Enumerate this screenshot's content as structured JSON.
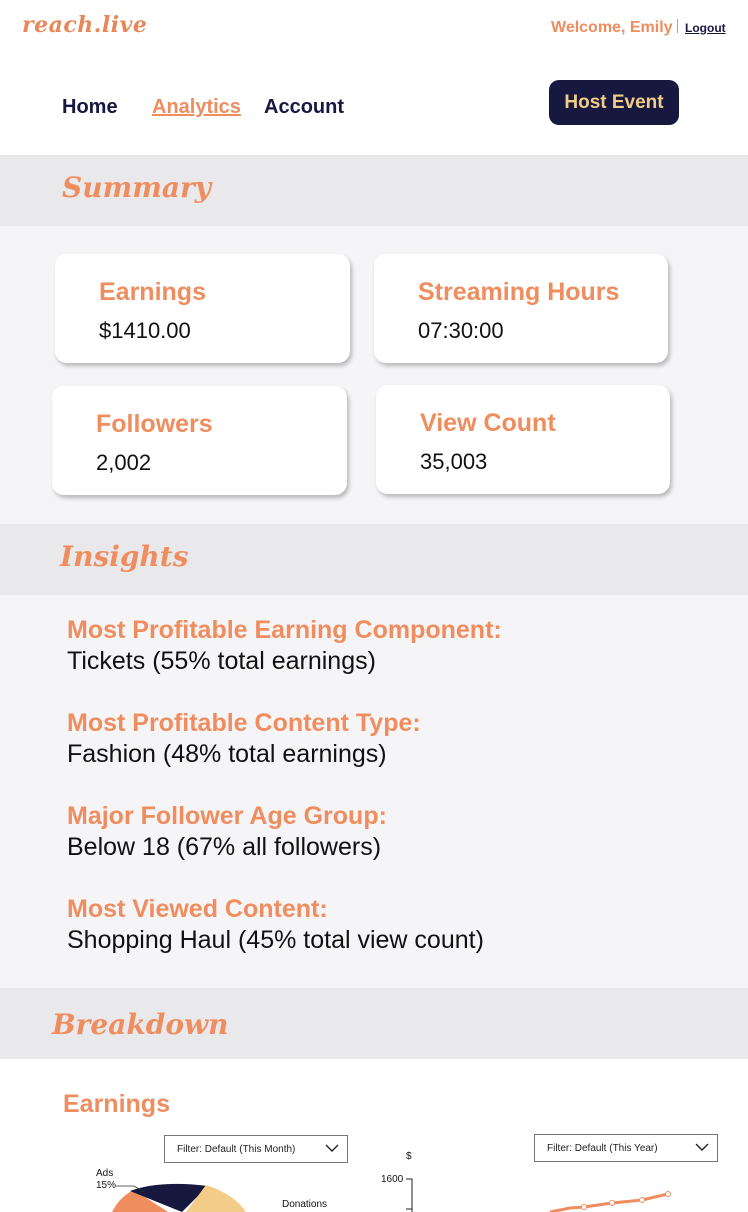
{
  "header": {
    "logo": "reach.live",
    "welcome": "Welcome, Emily",
    "logout": "Logout"
  },
  "nav": {
    "home": "Home",
    "analytics": "Analytics",
    "account": "Account",
    "host_event": "Host Event"
  },
  "summary": {
    "title": "Summary",
    "cards": [
      {
        "label": "Earnings",
        "value": "$1410.00"
      },
      {
        "label": "Streaming Hours",
        "value": "07:30:00"
      },
      {
        "label": "Followers",
        "value": "2,002"
      },
      {
        "label": "View Count",
        "value": "35,003"
      }
    ]
  },
  "insights": {
    "title": "Insights",
    "items": [
      {
        "label": "Most Profitable Earning Component:",
        "value": "Tickets (55% total earnings)"
      },
      {
        "label": "Most Profitable Content Type:",
        "value": "Fashion (48% total earnings)"
      },
      {
        "label": "Major Follower Age Group:",
        "value": "Below 18 (67% all followers)"
      },
      {
        "label": "Most Viewed Content:",
        "value": "Shopping Haul (45% total view count)"
      }
    ]
  },
  "breakdown": {
    "title": "Breakdown",
    "earnings_title": "Earnings",
    "pie_filter": "Filter:  Default (This Month)",
    "line_filter": "Filter:  Default (This Year)",
    "pie": {
      "ads_label": "Ads",
      "ads_pct": "15%",
      "donations_label": "Donations"
    },
    "line": {
      "y_unit": "$",
      "y_tick_top": "1600"
    }
  },
  "colors": {
    "accent": "#ef8d5f",
    "navy": "#16183f",
    "gold": "#f3cd88",
    "band": "#e9e9eb"
  }
}
